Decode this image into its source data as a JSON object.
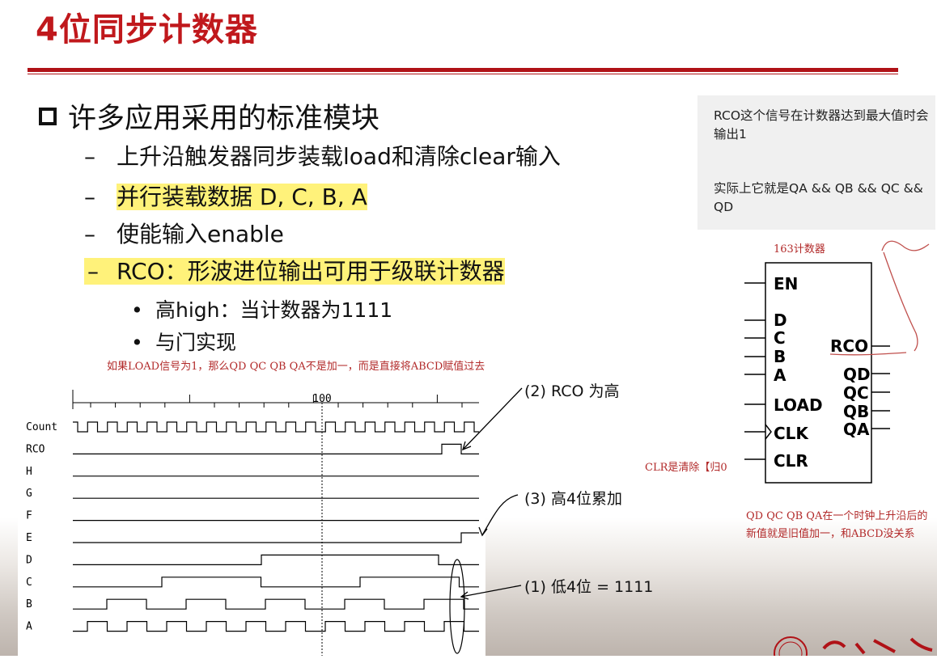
{
  "title": "4位同步计数器",
  "bullet_main": "许多应用采用的标准模块",
  "sub_bullets": [
    "上升沿触发器同步装载load和清除clear输入",
    "并行装载数据 D, C, B, A",
    "使能输入enable",
    "RCO：形波进位输出可用于级联计数器"
  ],
  "sub_sub_bullets": [
    "高high：当计数器为1111",
    "与门实现"
  ],
  "load_note": "如果LOAD信号为1，那么QD QC QB QA不是加一，而是直接将ABCD赋值过去",
  "chat": {
    "msg1": "RCO这个信号在计数器达到最大值时会输出1",
    "msg2": "实际上它就是QA && QB && QC && QD"
  },
  "counter": {
    "caption": "163计数器",
    "pins_left": [
      "EN",
      "D",
      "C",
      "B",
      "A",
      "LOAD",
      "CLK",
      "CLR"
    ],
    "pins_right": [
      "RCO",
      "QD",
      "QC",
      "QB",
      "QA"
    ]
  },
  "clr_note": "CLR是清除【归0",
  "q_note": "QD QC QB QA在一个时钟上升沿后的新值就是旧值加一，和ABCD没关系",
  "timing": {
    "tick_label": "100",
    "signals": [
      "Count",
      "RCO",
      "H",
      "G",
      "F",
      "E",
      "D",
      "C",
      "B",
      "A"
    ]
  },
  "annotations": {
    "rco_high": "(2) RCO 为高",
    "upper_accum": "(3) 高4位累加",
    "lower_1111": "(1) 低4位 = 1111"
  },
  "colors": {
    "title": "#c0181c",
    "rule": "#b01217",
    "highlight": "#fff27a",
    "note": "#b22a2a"
  }
}
